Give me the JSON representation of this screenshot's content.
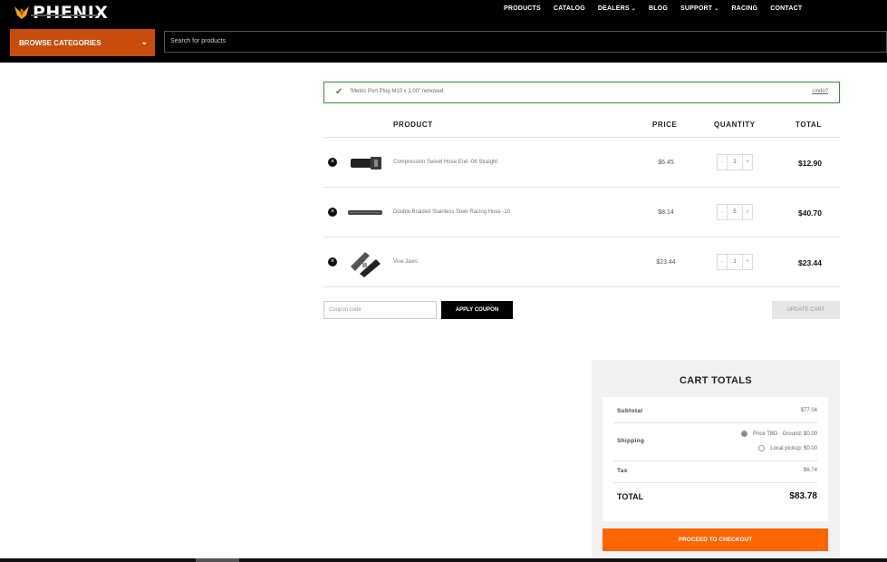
{
  "brand": {
    "name": "PHENIX",
    "accent": "#c84c0c",
    "checkout_color": "#ff6600"
  },
  "nav": [
    {
      "label": "PRODUCTS",
      "dropdown": false
    },
    {
      "label": "CATALOG",
      "dropdown": false
    },
    {
      "label": "DEALERS",
      "dropdown": true
    },
    {
      "label": "BLOG",
      "dropdown": false
    },
    {
      "label": "SUPPORT",
      "dropdown": true
    },
    {
      "label": "RACING",
      "dropdown": false
    },
    {
      "label": "CONTACT",
      "dropdown": false
    }
  ],
  "browse": {
    "label": "BROWSE CATEGORIES"
  },
  "search": {
    "placeholder": "Search for products"
  },
  "notice": {
    "message": "“Metric Port Plug M10 x 1.00” removed.",
    "undo": "Undo?"
  },
  "table": {
    "headers": {
      "product": "PRODUCT",
      "price": "PRICE",
      "quantity": "QUANTITY",
      "total": "TOTAL"
    },
    "rows": [
      {
        "name": "Compression Swivel Hose End -06 Straight",
        "price": "$6.45",
        "qty": "2",
        "total": "$12.90",
        "thumb": "fitting"
      },
      {
        "name": "Double Braided Stainless Steel Racing Hose -10",
        "price": "$8.14",
        "qty": "5",
        "total": "$40.70",
        "thumb": "hose"
      },
      {
        "name": "Vise Jaws",
        "price": "$23.44",
        "qty": "1",
        "total": "$23.44",
        "thumb": "jaws"
      }
    ]
  },
  "coupon": {
    "placeholder": "Coupon code",
    "apply": "APPLY COUPON",
    "update": "UPDATE CART"
  },
  "cart_totals": {
    "title": "CART TOTALS",
    "subtotal_label": "Subtotal",
    "subtotal": "$77.04",
    "shipping_label": "Shipping",
    "shipping_options": [
      "Price TBD · Ground: $0.00",
      "Local pickup: $0.00"
    ],
    "tax_label": "Tax",
    "tax": "$6.74",
    "total_label": "TOTAL",
    "total": "$83.78",
    "checkout": "PROCEED TO CHECKOUT"
  }
}
